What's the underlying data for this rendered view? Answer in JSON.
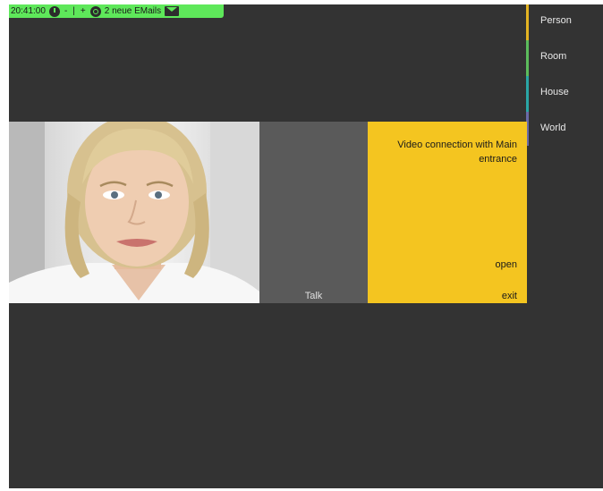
{
  "status_bar": {
    "time": "20:41:00",
    "minus_label": "-",
    "separator": "|",
    "plus_label": "+",
    "email_notice": "2 neue EMails",
    "background_color": "#5ee85a",
    "icons": [
      "clock-icon",
      "mail-status-icon",
      "envelope-icon"
    ]
  },
  "nav": {
    "items": [
      {
        "label": "Person",
        "color": "#e4b422"
      },
      {
        "label": "Room",
        "color": "#5cbc5c"
      },
      {
        "label": "House",
        "color": "#2aa6a6"
      },
      {
        "label": "World",
        "color": "#6a6aa8"
      }
    ]
  },
  "video": {
    "talk_label": "Talk"
  },
  "info_panel": {
    "message": "Video connection with Main entrance",
    "open_label": "open",
    "exit_label": "exit",
    "background_color": "#f4c520"
  }
}
